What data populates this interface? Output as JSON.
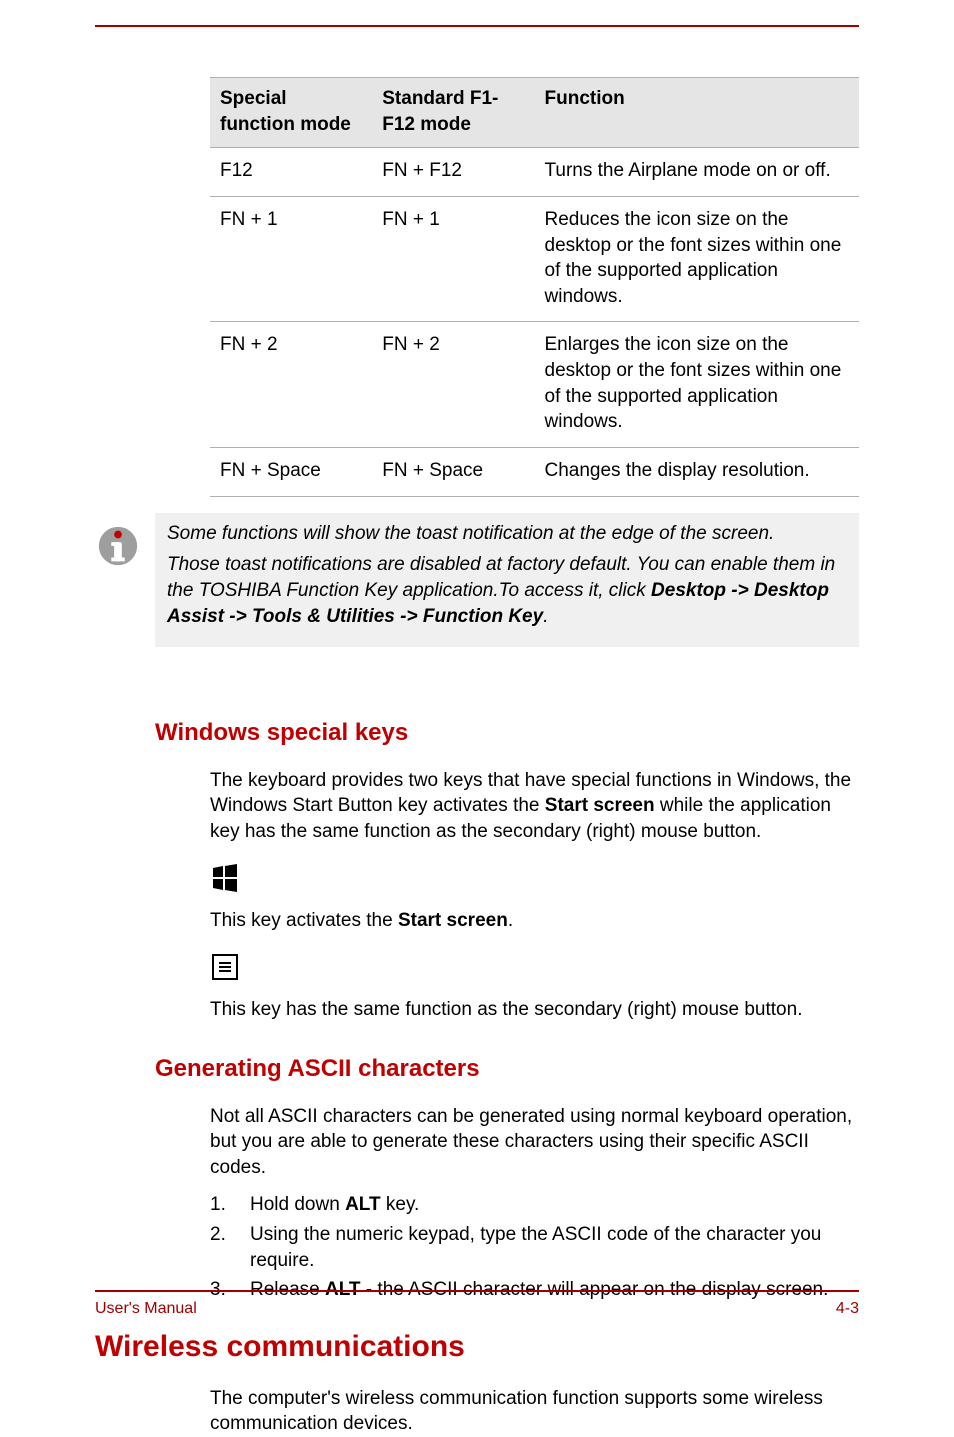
{
  "table": {
    "headers": {
      "col1": "Special function mode",
      "col2": "Standard F1-F12 mode",
      "col3": "Function"
    },
    "rows": [
      {
        "c1": "F12",
        "c2": "FN + F12",
        "c3": "Turns the Airplane mode on or off."
      },
      {
        "c1": "FN + 1",
        "c2": "FN + 1",
        "c3": "Reduces the icon size on the desktop or the font sizes within one of the supported application windows."
      },
      {
        "c1": "FN + 2",
        "c2": "FN + 2",
        "c3": "Enlarges the icon size on the desktop or the font sizes within one of the supported application windows."
      },
      {
        "c1": "FN + Space",
        "c2": "FN + Space",
        "c3": "Changes the display resolution."
      }
    ]
  },
  "note": {
    "p1": "Some functions will show the toast notification at the edge of the screen.",
    "p2a": "Those toast notifications are disabled at factory default. You can enable them in the TOSHIBA Function Key application.To access it, click ",
    "p2b": "Desktop -> Desktop Assist -> Tools & Utilities -> Function Key",
    "p2c": "."
  },
  "section_windows": {
    "heading": "Windows special keys",
    "intro_a": "The keyboard provides two keys that have special functions in Windows, the Windows Start Button key activates the ",
    "intro_bold1": "Start screen",
    "intro_b": " while the application key has the same function as the secondary (right) mouse button.",
    "start_text_a": "This key activates the ",
    "start_text_bold": "Start screen",
    "start_text_b": ".",
    "app_text": "This key has the same function as the secondary (right) mouse button."
  },
  "section_ascii": {
    "heading": "Generating ASCII characters",
    "intro": "Not all ASCII characters can be generated using normal keyboard operation, but you are able to generate these characters using their specific ASCII codes.",
    "step1_a": "Hold down ",
    "step1_bold": "ALT",
    "step1_b": " key.",
    "step2": "Using the numeric keypad, type the ASCII code of the character you require.",
    "step3_a": "Release ",
    "step3_bold": "ALT",
    "step3_b": " - the ASCII character will appear on the display screen."
  },
  "section_wireless": {
    "heading": "Wireless communications",
    "intro": "The computer's wireless communication function supports some wireless communication devices."
  },
  "footer": {
    "manual": "User's Manual",
    "page": "4-3"
  }
}
